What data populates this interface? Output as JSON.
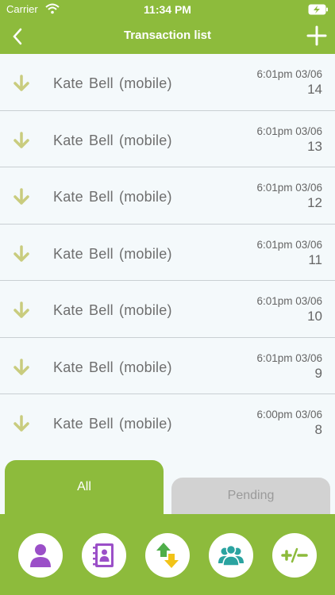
{
  "status_bar": {
    "carrier": "Carrier",
    "time": "11:34 PM"
  },
  "nav": {
    "title": "Transaction list"
  },
  "transactions": [
    {
      "name": "Kate  Bell (mobile)",
      "time": "6:01pm 03/06",
      "number": "14"
    },
    {
      "name": "Kate  Bell (mobile)",
      "time": "6:01pm 03/06",
      "number": "13"
    },
    {
      "name": "Kate  Bell (mobile)",
      "time": "6:01pm 03/06",
      "number": "12"
    },
    {
      "name": "Kate  Bell (mobile)",
      "time": "6:01pm 03/06",
      "number": "11"
    },
    {
      "name": "Kate  Bell (mobile)",
      "time": "6:01pm 03/06",
      "number": "10"
    },
    {
      "name": "Kate  Bell (mobile)",
      "time": "6:01pm 03/06",
      "number": "9"
    },
    {
      "name": "Kate  Bell (mobile)",
      "time": "6:00pm 03/06",
      "number": "8"
    }
  ],
  "tabs": {
    "all": "All",
    "pending": "Pending"
  },
  "toolbar_icons": [
    "profile-icon",
    "contacts-book-icon",
    "transfer-arrows-icon",
    "group-icon",
    "plus-minus-icon"
  ],
  "colors": {
    "accent": "#8dbb3c",
    "arrow": "#c9cc7e",
    "purple": "#9b4fc8",
    "teal": "#2aa3a0",
    "yellow": "#f2c318"
  }
}
